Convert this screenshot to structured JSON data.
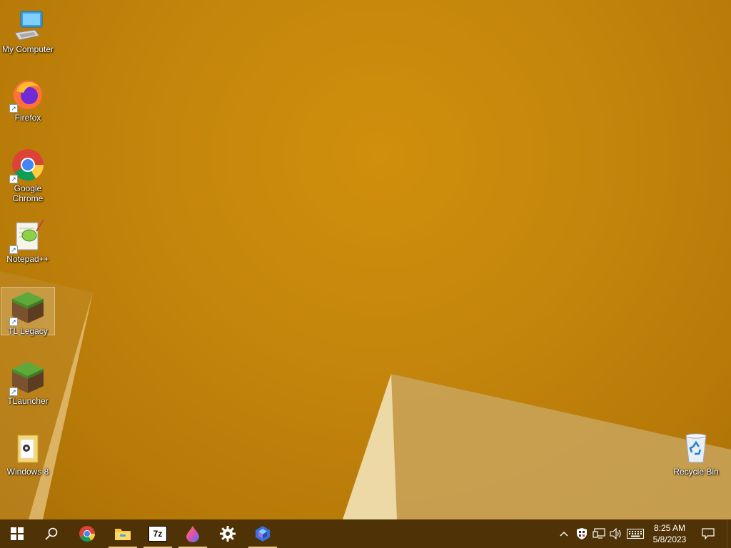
{
  "desktop": {
    "icons": [
      {
        "label": "My Computer"
      },
      {
        "label": "Firefox"
      },
      {
        "label": "Google Chrome"
      },
      {
        "label": "Notepad++"
      },
      {
        "label": "TL Legacy"
      },
      {
        "label": "TLauncher"
      },
      {
        "label": "Windows 8"
      },
      {
        "label": "Recycle Bin"
      }
    ]
  },
  "taskbar": {
    "pinned": [
      "start-icon",
      "search-icon",
      "chrome-icon",
      "file-explorer-icon",
      "7zip-icon",
      "paint-drop-icon",
      "settings-gear-icon",
      "photos-icon"
    ],
    "sevenzip_text": "7z",
    "clock": {
      "time": "8:25 AM",
      "date": "5/8/2023"
    }
  },
  "colors": {
    "wallpaper": "#c88a0c",
    "taskbar": "#4f3306",
    "accent": "#e8c98a"
  }
}
